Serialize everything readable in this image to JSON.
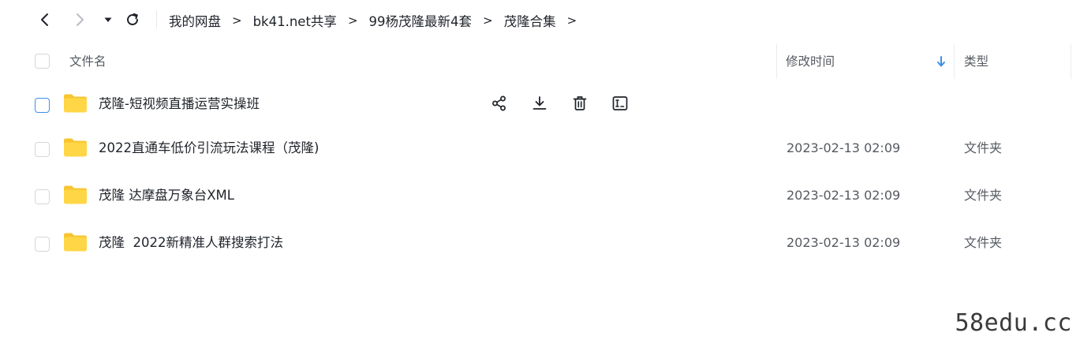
{
  "nav": {
    "breadcrumb": [
      "我的网盘",
      "bk41.net共享",
      "99杨茂隆最新4套",
      "茂隆合集"
    ],
    "separator": ">"
  },
  "header": {
    "name_label": "文件名",
    "mtime_label": "修改时间",
    "type_label": "类型",
    "sort": "desc"
  },
  "files": [
    {
      "name": "茂隆-短视频直播运营实操班",
      "mtime": "",
      "type": ""
    },
    {
      "name": "2022直通车低价引流玩法课程（茂隆)",
      "mtime": "2023-02-13 02:09",
      "type": "文件夹"
    },
    {
      "name": "茂隆 达摩盘万象台XML",
      "mtime": "2023-02-13 02:09",
      "type": "文件夹"
    },
    {
      "name": "茂隆  2022新精准人群搜索打法",
      "mtime": "2023-02-13 02:09",
      "type": "文件夹"
    }
  ],
  "hover_actions": [
    "share-icon",
    "download-icon",
    "delete-icon",
    "rename-icon"
  ],
  "colors": {
    "accent": "#3e8fe8",
    "folder": "#ffd645",
    "folder_tab": "#f7c531",
    "text": "#1f2329",
    "muted": "#555a61"
  },
  "watermark": "58edu.cc"
}
